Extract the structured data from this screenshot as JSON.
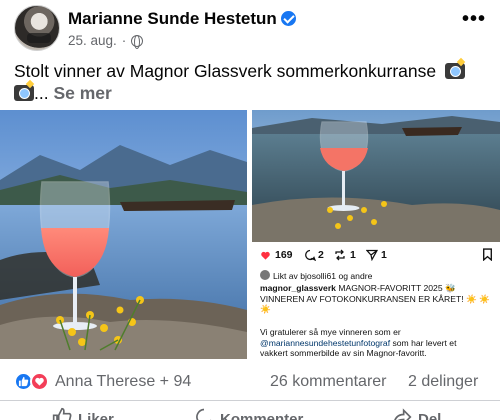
{
  "post": {
    "author": "Marianne Sunde Hestetun",
    "date": "25. aug.",
    "separator": "·",
    "text": "Stolt  vinner av Magnor Glassverk sommerkonkurranse",
    "text_suffix": "...",
    "see_more": "Se mer",
    "more_menu": "•••"
  },
  "instagram_card": {
    "likes": "169",
    "comments": "2",
    "reposts": "1",
    "shares": "1",
    "liked_by": "Likt av bjosolli61 og andre",
    "username": "magnor_glassverk",
    "caption_line1": "MAGNOR-FAVORITT 2025 🐝",
    "caption_line2": "VINNEREN AV FOTOKONKURRANSEN ER KÅRET! ☀️ ☀️",
    "caption_line3": "☀️",
    "body_line1": "Vi gratulerer så mye vinneren som er",
    "mention": "@mariannesundehestetunfotograf",
    "body_line2_rest": " som har levert et",
    "body_line3": "vakkert sommerbilde av sin Magnor-favoritt."
  },
  "reactions": {
    "names": "Anna Therese + 94",
    "comments": "26 kommentarer",
    "shares": "2 delinger"
  },
  "actions": {
    "like": "Liker",
    "comment": "Kommenter",
    "share": "Del"
  },
  "colors": {
    "accent": "#1877f2",
    "love": "#f33e58",
    "secondary_text": "#65676b"
  }
}
